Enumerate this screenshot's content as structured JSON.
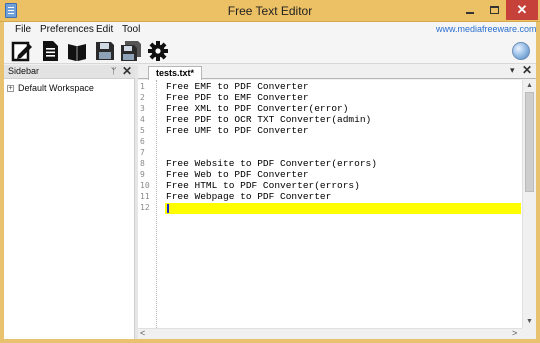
{
  "window": {
    "title": "Free Text Editor",
    "minimize_icon": "minimize-icon",
    "maximize_icon": "maximize-icon",
    "close_glyph": "✕"
  },
  "menu": {
    "items": [
      "File",
      "Preferences",
      "Edit",
      "Tool"
    ],
    "website": "www.mediafreeware.com"
  },
  "toolbar": {
    "buttons": [
      {
        "icon": "new-document-pencil-icon"
      },
      {
        "icon": "document-icon"
      },
      {
        "icon": "open-book-icon"
      },
      {
        "icon": "save-floppy-icon"
      },
      {
        "icon": "save-all-floppy-icon"
      },
      {
        "icon": "gear-icon"
      }
    ],
    "globe_icon": "globe-icon"
  },
  "sidebar": {
    "title": "Sidebar",
    "pin_glyph": "ᛘ",
    "close_glyph": "✕",
    "tree": [
      {
        "expander": "+",
        "label": "Default Workspace"
      }
    ]
  },
  "editor": {
    "tab_label": "tests.txt*",
    "tab_dropdown_glyph": "▾",
    "tab_close_glyph": "✕",
    "line_numbers": [
      "1",
      "2",
      "3",
      "4",
      "5",
      "6",
      "7",
      "8",
      "9",
      "10",
      "11",
      "12"
    ],
    "lines": [
      "Free EMF to PDF Converter",
      "Free PDF to EMF Converter",
      "Free XML to PDF Converter(error)",
      "Free PDF to OCR TXT Converter(admin)",
      "Free UMF to PDF Converter",
      "",
      "",
      "Free Website to PDF Converter(errors)",
      "Free Web to PDF Converter",
      "Free HTML to PDF Converter(errors)",
      "Free Webpage to PDF Converter",
      ""
    ],
    "current_line": 12,
    "highlight_color": "#ffff00",
    "scroll_up_glyph": "▲",
    "scroll_down_glyph": "▼",
    "scroll_left_glyph": "<",
    "scroll_right_glyph": ">"
  },
  "colors": {
    "title_bar": "#ecc064",
    "close_button": "#c7413b",
    "link": "#2a6fd1"
  }
}
